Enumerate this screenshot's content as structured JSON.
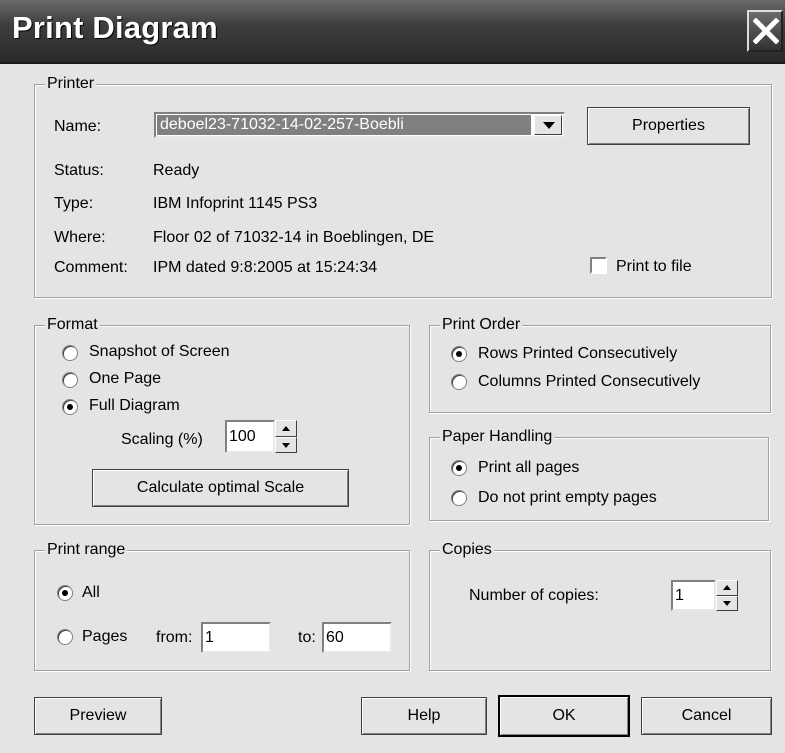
{
  "window": {
    "title": "Print Diagram"
  },
  "printer": {
    "legend": "Printer",
    "name_label": "Name:",
    "name_value": "deboel23-71032-14-02-257-Boebli",
    "properties_label": "Properties",
    "status_label": "Status:",
    "status_value": "Ready",
    "type_label": "Type:",
    "type_value": "IBM Infoprint 1145 PS3",
    "where_label": "Where:",
    "where_value": "Floor 02 of 71032-14 in Boeblingen, DE",
    "comment_label": "Comment:",
    "comment_value": "IPM dated 9:8:2005 at 15:24:34",
    "print_to_file_label": "Print to file",
    "print_to_file_checked": false
  },
  "format": {
    "legend": "Format",
    "options": [
      "Snapshot of Screen",
      "One Page",
      "Full Diagram"
    ],
    "selected": "Full Diagram",
    "scaling_label": "Scaling (%)",
    "scaling_value": "100",
    "calc_button": "Calculate optimal Scale"
  },
  "print_order": {
    "legend": "Print Order",
    "options": [
      "Rows Printed Consecutively",
      "Columns Printed Consecutively"
    ],
    "selected": "Rows Printed Consecutively"
  },
  "paper_handling": {
    "legend": "Paper Handling",
    "options": [
      "Print all pages",
      "Do not print empty pages"
    ],
    "selected": "Print all pages"
  },
  "print_range": {
    "legend": "Print range",
    "all_label": "All",
    "pages_label": "Pages",
    "from_label": "from:",
    "from_value": "1",
    "to_label": "to:",
    "to_value": "60",
    "selected": "All"
  },
  "copies": {
    "legend": "Copies",
    "number_label": "Number of copies:",
    "number_value": "1"
  },
  "buttons": {
    "preview": "Preview",
    "help": "Help",
    "ok": "OK",
    "cancel": "Cancel"
  },
  "icons": {
    "close": "close-icon",
    "dropdown": "chevron-down-icon",
    "spin_up": "arrow-up-icon",
    "spin_down": "arrow-down-icon"
  }
}
